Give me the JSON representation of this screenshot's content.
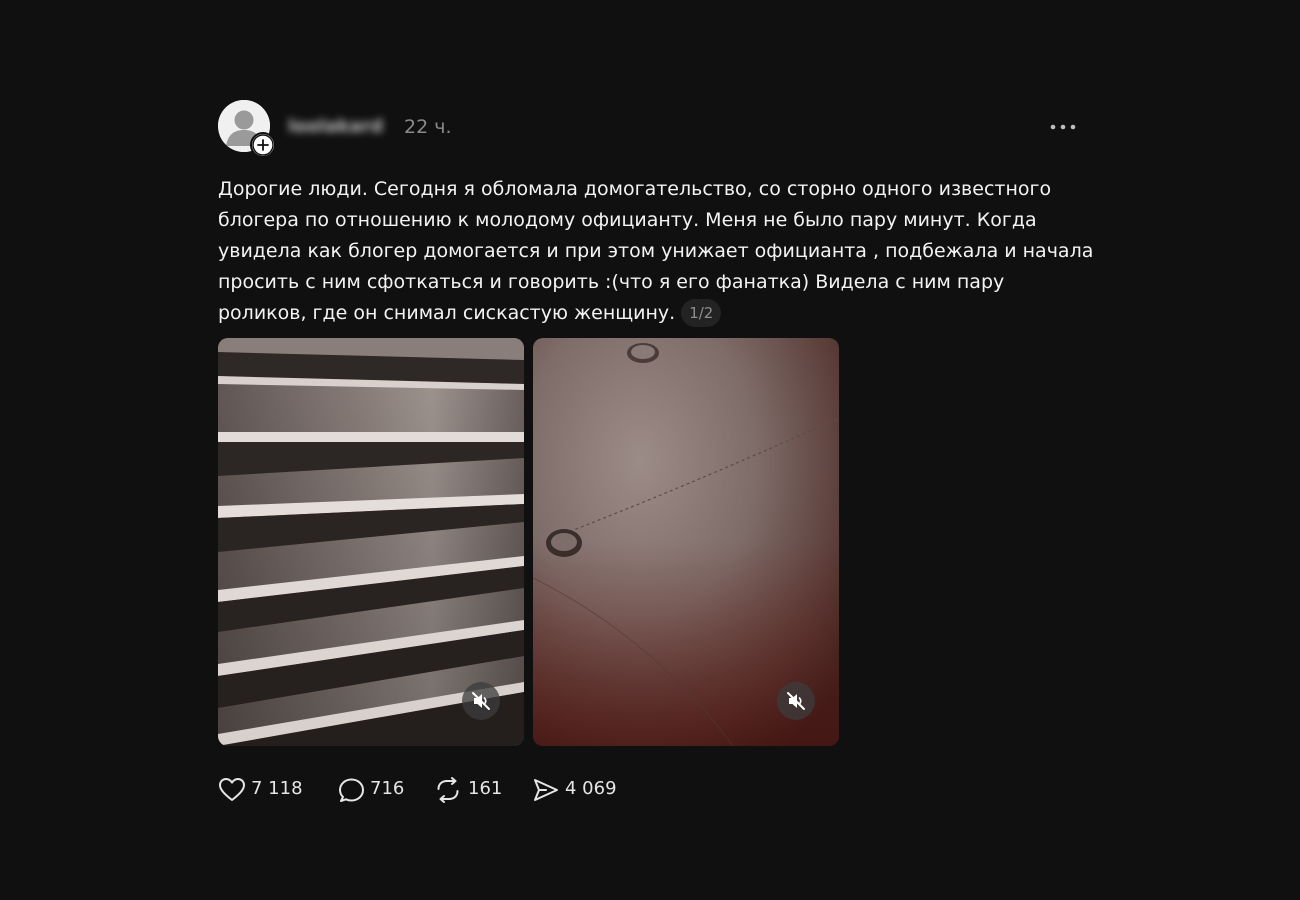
{
  "post": {
    "author": {
      "username": "loolakard",
      "avatar_icon": "user-placeholder-icon",
      "follow_icon": "plus-icon"
    },
    "timestamp": "22 ч.",
    "menu_icon": "more-horizontal-icon",
    "text_lines": [
      "Дорогие люди. Сегодня я обломала домогательство, со сторно одного известного",
      "блогера по отношению к молодому официанту. Меня не было пару минут. Когда",
      "увидела как блогер домогается и при этом унижает официанта , подбежала и начала",
      "просить с ним сфоткаться и говорить :(что я его фанатка) Видела с ним пару",
      "роликов, где он снимал сискастую женщину."
    ],
    "page_indicator": "1/2",
    "media": [
      {
        "kind": "video",
        "muted_icon": "volume-muted-icon"
      },
      {
        "kind": "video",
        "muted_icon": "volume-muted-icon"
      }
    ],
    "actions": {
      "likes": {
        "icon": "heart-icon",
        "count": "7 118"
      },
      "comments": {
        "icon": "comment-icon",
        "count": "716"
      },
      "reposts": {
        "icon": "repost-icon",
        "count": "161"
      },
      "shares": {
        "icon": "send-icon",
        "count": "4 069"
      }
    }
  },
  "colors": {
    "background": "#101010",
    "text": "#f3f3f3",
    "muted_text": "#8a8a8a"
  }
}
